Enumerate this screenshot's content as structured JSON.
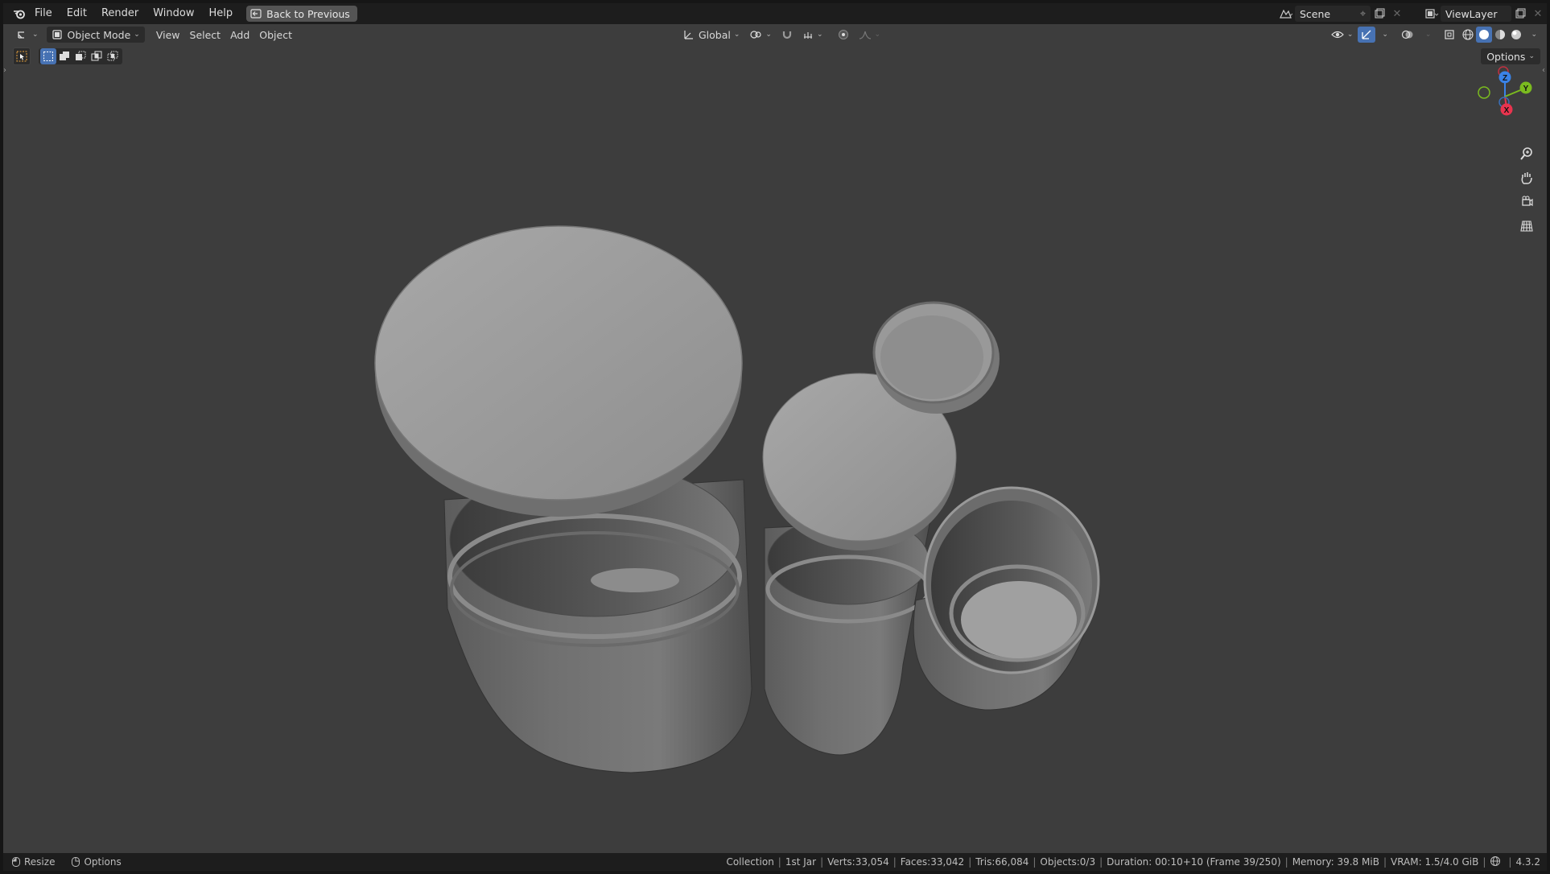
{
  "menubar": {
    "items": [
      "File",
      "Edit",
      "Render",
      "Window",
      "Help"
    ],
    "back_button": "Back to Previous",
    "scene_field": "Scene",
    "viewlayer_field": "ViewLayer"
  },
  "viewport_header": {
    "mode": "Object Mode",
    "menus": [
      "View",
      "Select",
      "Add",
      "Object"
    ],
    "transform_orientation": "Global",
    "options_label": "Options"
  },
  "gizmo": {
    "axes": [
      "Z",
      "Y",
      "X"
    ]
  },
  "status": {
    "left": [
      "Resize",
      "Options"
    ],
    "collection": "Collection",
    "object": "1st Jar",
    "verts": "Verts:33,054",
    "faces": "Faces:33,042",
    "tris": "Tris:66,084",
    "objects": "Objects:0/3",
    "duration": "Duration: 00:10+10 (Frame 39/250)",
    "memory": "Memory: 39.8 MiB",
    "vram": "VRAM: 1.5/4.0 GiB",
    "version": "4.3.2"
  },
  "colors": {
    "accent": "#4772b3",
    "axis_x": "#e8344e",
    "axis_y": "#7bbb1f",
    "axis_z": "#3a83e8"
  }
}
